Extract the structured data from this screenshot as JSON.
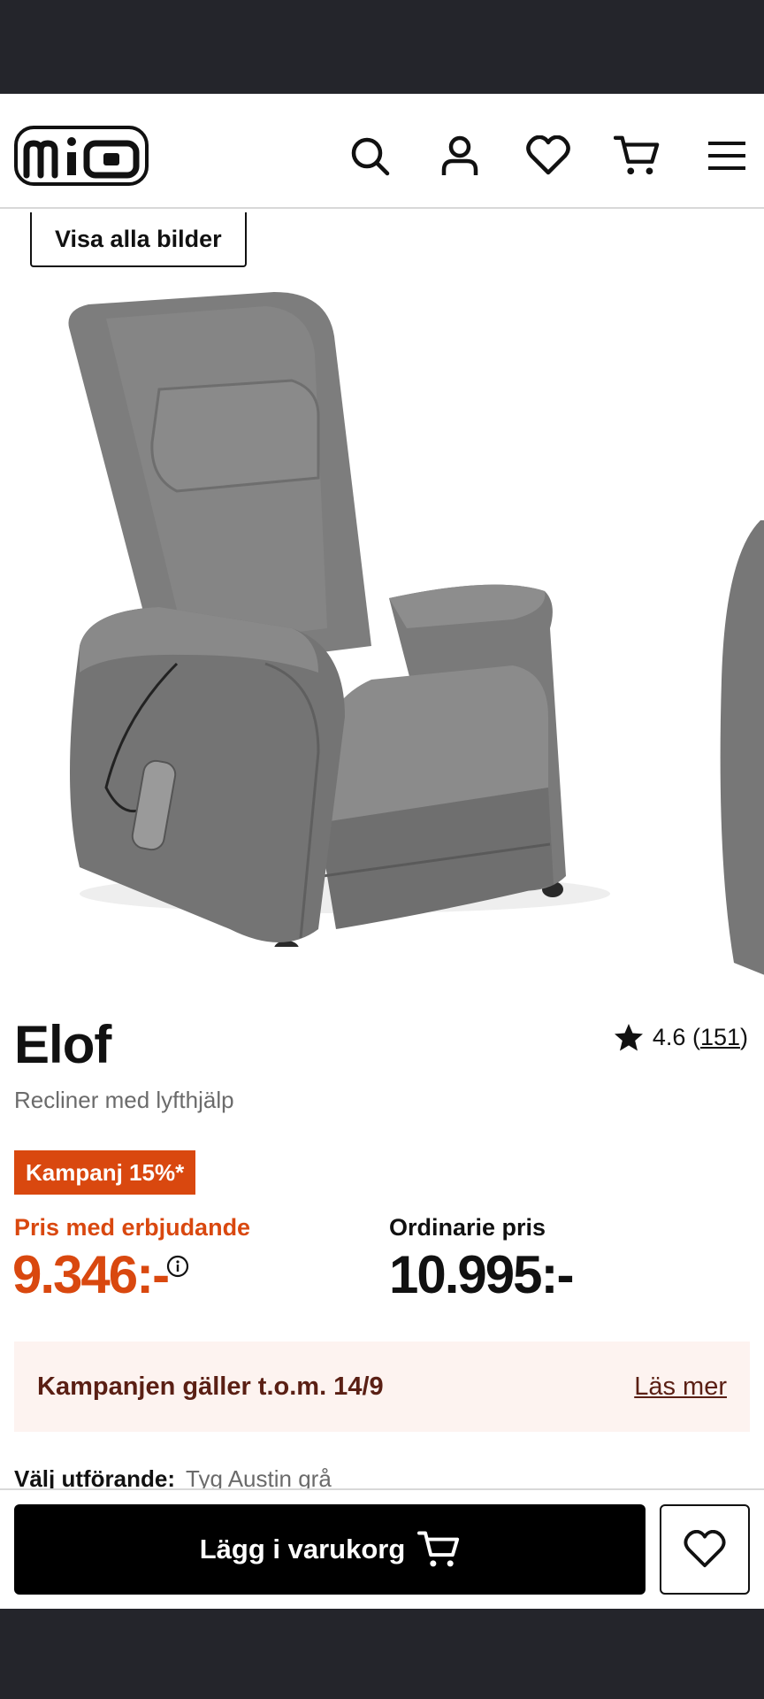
{
  "header": {
    "logo_text": "mio",
    "icons": [
      "search-icon",
      "user-icon",
      "heart-icon",
      "cart-icon",
      "menu-icon"
    ]
  },
  "gallery": {
    "view_all_label": "Visa alla bilder"
  },
  "product": {
    "title": "Elof",
    "subtitle": "Recliner med lyfthjälp",
    "rating_value": "4.6",
    "rating_count": "151",
    "campaign_badge": "Kampanj 15%*",
    "offer_label": "Pris med erbjudande",
    "offer_price": "9.346:-",
    "ordinary_label": "Ordinarie pris",
    "ordinary_price": "10.995:-"
  },
  "banner": {
    "text": "Kampanjen gäller t.o.m. 14/9",
    "link": "Läs mer"
  },
  "variant": {
    "label": "Välj utförande:",
    "value": "Tyg Austin grå"
  },
  "sticky": {
    "add_to_cart_label": "Lägg i varukorg"
  },
  "colors": {
    "accent": "#d9480f",
    "banner_bg": "#fdf3f0",
    "banner_text": "#5a1f14",
    "chair_fabric": "#7a7a7a"
  }
}
